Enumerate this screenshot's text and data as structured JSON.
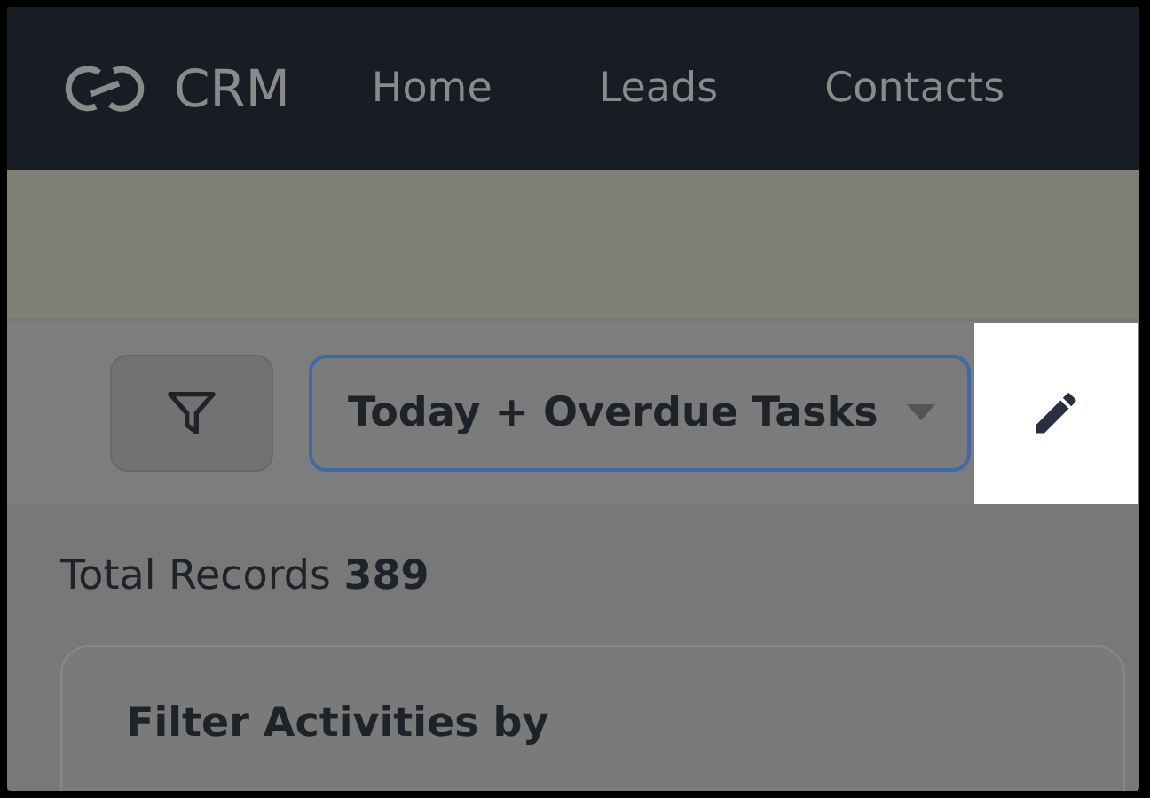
{
  "nav": {
    "brand": "CRM",
    "items": [
      {
        "label": "Home"
      },
      {
        "label": "Leads"
      },
      {
        "label": "Contacts"
      }
    ]
  },
  "toolbar": {
    "view": "Today + Overdue Tasks",
    "edit_highlighted": true
  },
  "summary": "Total Records **389**",
  "filter_panel": {
    "title": "Filter Activities by"
  }
}
